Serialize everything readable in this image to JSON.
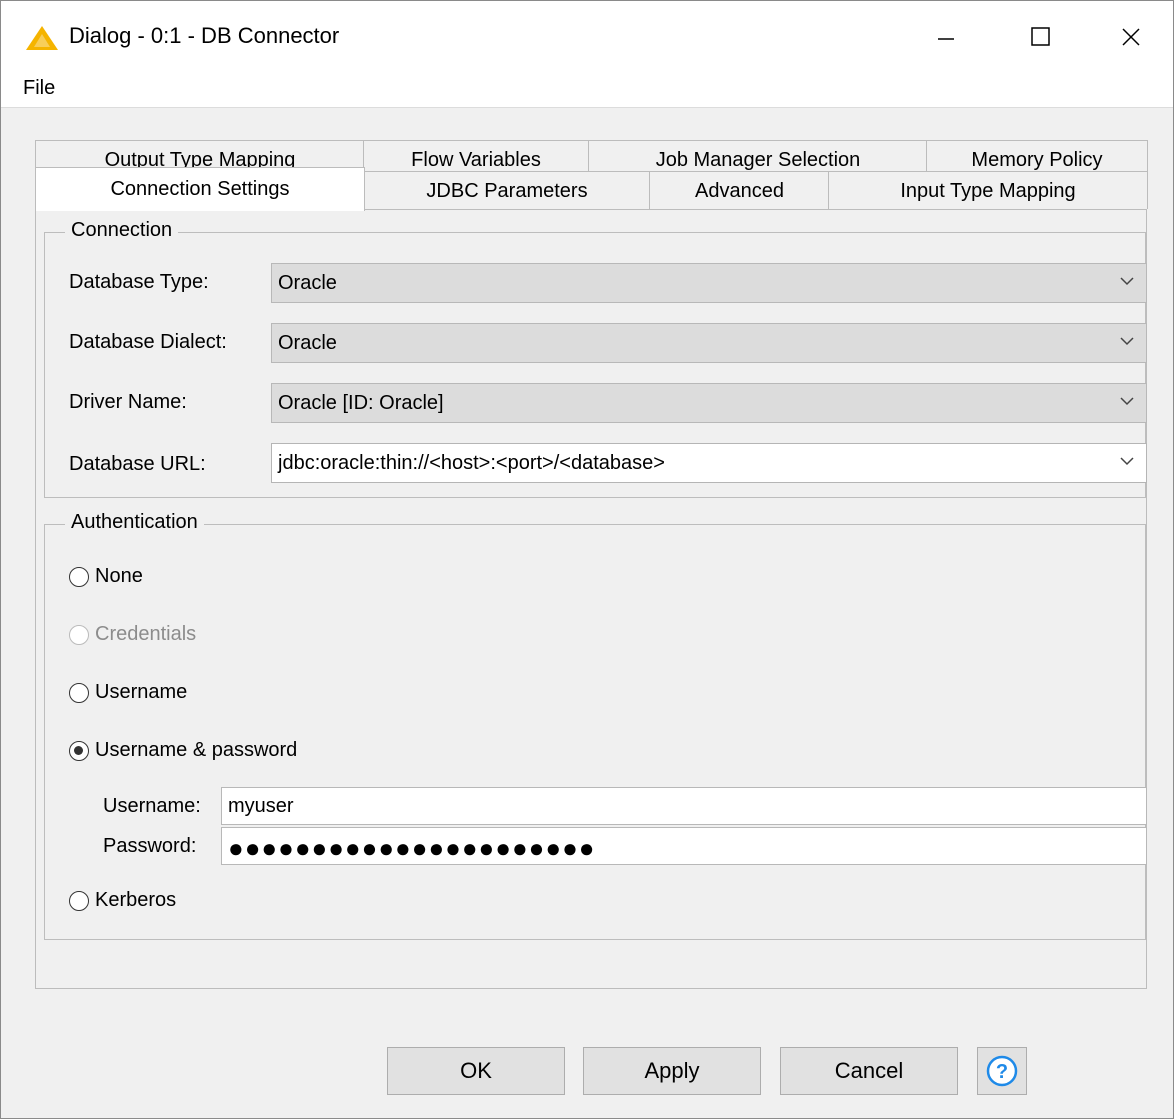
{
  "window": {
    "title": "Dialog - 0:1 - DB Connector",
    "icon": "warning-triangle-icon",
    "controls": {
      "minimize": "—",
      "maximize": "☐",
      "close": "✕"
    }
  },
  "menu": {
    "file": "File"
  },
  "tabs": {
    "row_back": [
      "Output Type Mapping",
      "Flow Variables",
      "Job Manager Selection",
      "Memory Policy"
    ],
    "row_front": [
      "Connection Settings",
      "JDBC Parameters",
      "Advanced",
      "Input Type Mapping"
    ],
    "active": "Connection Settings"
  },
  "connection": {
    "legend": "Connection",
    "database_type_label": "Database Type:",
    "database_type_value": "Oracle",
    "dialect_label": "Database Dialect:",
    "dialect_value": "Oracle",
    "driver_label": "Driver Name:",
    "driver_value": "Oracle [ID: Oracle]",
    "url_label": "Database URL:",
    "url_value": "jdbc:oracle:thin://<host>:<port>/<database>"
  },
  "authentication": {
    "legend": "Authentication",
    "options": [
      {
        "label": "None",
        "checked": false,
        "enabled": true
      },
      {
        "label": "Credentials",
        "checked": false,
        "enabled": false
      },
      {
        "label": "Username",
        "checked": false,
        "enabled": true
      },
      {
        "label": "Username & password",
        "checked": true,
        "enabled": true
      },
      {
        "label": "Kerberos",
        "checked": false,
        "enabled": true
      }
    ],
    "username_label": "Username:",
    "username_value": "myuser",
    "password_label": "Password:",
    "password_mask": "●●●●●●●●●●●●●●●●●●●●●●"
  },
  "buttons": {
    "ok": "OK",
    "apply": "Apply",
    "cancel": "Cancel",
    "help": "?"
  },
  "colors": {
    "accent": "#1f8ae8",
    "warning_icon": "#f5b400"
  }
}
